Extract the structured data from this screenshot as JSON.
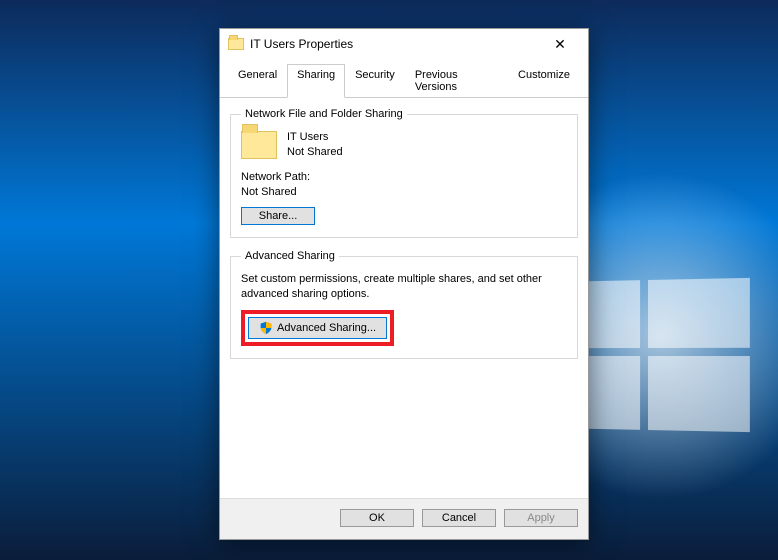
{
  "window": {
    "title": "IT Users Properties"
  },
  "tabs": {
    "general": "General",
    "sharing": "Sharing",
    "security": "Security",
    "previous_versions": "Previous Versions",
    "customize": "Customize",
    "active": "sharing"
  },
  "network_sharing": {
    "legend": "Network File and Folder Sharing",
    "folder_name": "IT Users",
    "status": "Not Shared",
    "path_label": "Network Path:",
    "path_value": "Not Shared",
    "share_button": "Share..."
  },
  "advanced_sharing": {
    "legend": "Advanced Sharing",
    "description": "Set custom permissions, create multiple shares, and set other advanced sharing options.",
    "button": "Advanced Sharing..."
  },
  "buttons": {
    "ok": "OK",
    "cancel": "Cancel",
    "apply": "Apply"
  }
}
